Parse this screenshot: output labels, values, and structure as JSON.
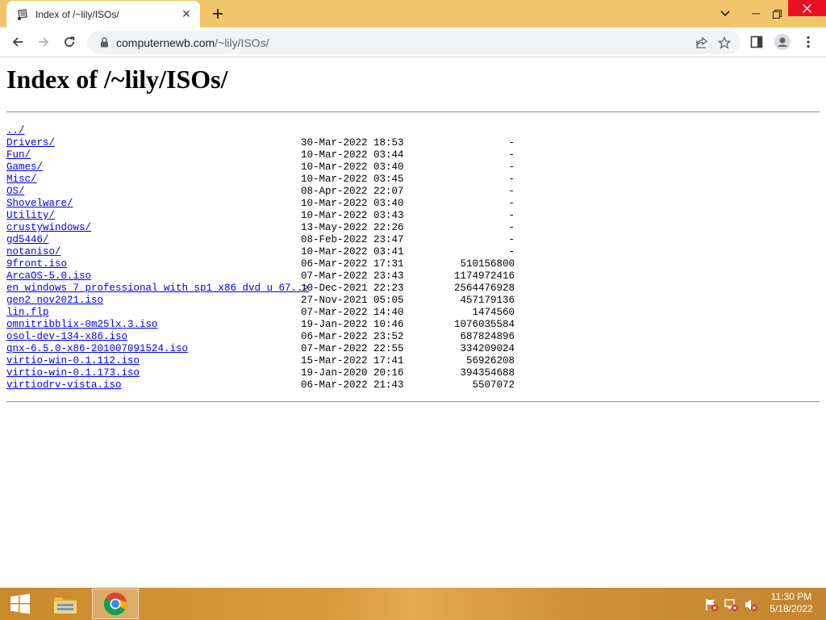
{
  "browser": {
    "tab": {
      "title": "Index of /~lily/ISOs/",
      "favicon": "file-server-icon"
    },
    "url": {
      "host": "computernewb.com",
      "path": "/~lily/ISOs/"
    }
  },
  "page": {
    "heading": "Index of /~lily/ISOs/",
    "parent_link": "../",
    "entries": [
      {
        "name": "Drivers/",
        "date": "30-Mar-2022 18:53",
        "size": "-"
      },
      {
        "name": "Fun/",
        "date": "10-Mar-2022 03:44",
        "size": "-"
      },
      {
        "name": "Games/",
        "date": "10-Mar-2022 03:40",
        "size": "-"
      },
      {
        "name": "Misc/",
        "date": "10-Mar-2022 03:45",
        "size": "-"
      },
      {
        "name": "OS/",
        "date": "08-Apr-2022 22:07",
        "size": "-"
      },
      {
        "name": "Shovelware/",
        "date": "10-Mar-2022 03:40",
        "size": "-"
      },
      {
        "name": "Utility/",
        "date": "10-Mar-2022 03:43",
        "size": "-"
      },
      {
        "name": "crustywindows/",
        "date": "13-May-2022 22:26",
        "size": "-"
      },
      {
        "name": "gd5446/",
        "date": "08-Feb-2022 23:47",
        "size": "-"
      },
      {
        "name": "notaniso/",
        "date": "10-Mar-2022 03:41",
        "size": "-"
      },
      {
        "name": "9front.iso",
        "date": "06-Mar-2022 17:31",
        "size": "510156800"
      },
      {
        "name": "ArcaOS-5.0.iso",
        "date": "07-Mar-2022 23:43",
        "size": "1174972416"
      },
      {
        "name": "en_windows_7_professional_with_sp1_x86_dvd_u_67..>",
        "date": "10-Dec-2021 22:23",
        "size": "2564476928"
      },
      {
        "name": "gen2_nov2021.iso",
        "date": "27-Nov-2021 05:05",
        "size": "457179136"
      },
      {
        "name": "lin.flp",
        "date": "07-Mar-2022 14:40",
        "size": "1474560"
      },
      {
        "name": "omnitribblix-0m25lx.3.iso",
        "date": "19-Jan-2022 10:46",
        "size": "1076035584"
      },
      {
        "name": "osol-dev-134-x86.iso",
        "date": "06-Mar-2022 23:52",
        "size": "687824896"
      },
      {
        "name": "qnx-6.5.0-x86-201007091524.iso",
        "date": "07-Mar-2022 22:55",
        "size": "334209024"
      },
      {
        "name": "virtio-win-0.1.112.iso",
        "date": "15-Mar-2022 17:41",
        "size": "56926208"
      },
      {
        "name": "virtio-win-0.1.173.iso",
        "date": "19-Jan-2020 20:16",
        "size": "394354688"
      },
      {
        "name": "virtiodrv-vista.iso",
        "date": "06-Mar-2022 21:43",
        "size": "5507072"
      }
    ]
  },
  "taskbar": {
    "clock": {
      "time": "11:30 PM",
      "date": "5/18/2022"
    },
    "colors": {
      "accent": "#d99a3a",
      "tabstrip": "#f1c66a",
      "link": "#0000ee"
    }
  }
}
